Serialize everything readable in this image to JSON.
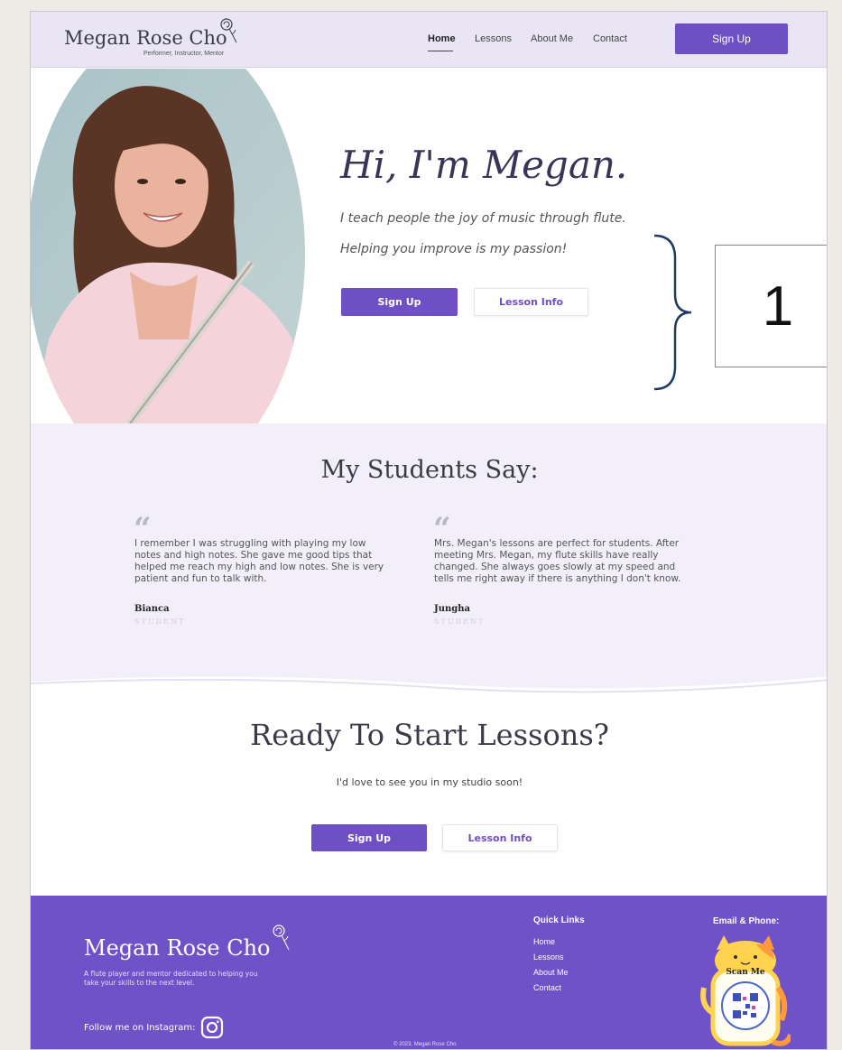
{
  "header": {
    "brand": "Megan Rose Cho",
    "tagline": "Performer, Instructor, Mentor",
    "nav": [
      "Home",
      "Lessons",
      "About Me",
      "Contact"
    ],
    "signup_label": "Sign Up"
  },
  "hero": {
    "title": "Hi, I'm Megan.",
    "line1": "I teach people the joy of music through flute.",
    "line2": "Helping you improve is my passion!",
    "signup_label": "Sign Up",
    "info_label": "Lesson Info",
    "annotation": "1"
  },
  "testimonials": {
    "title": "My Students Say:",
    "quote_glyph": "“",
    "items": [
      {
        "text": "I remember I was struggling with playing my low notes and high notes. She gave me good tips that helped me reach my high and low notes. She is very patient and fun to talk with.",
        "name": "Bianca",
        "role": "STUDENT"
      },
      {
        "text": "Mrs. Megan's lessons are perfect for students. After meeting Mrs. Megan, my flute skills have really changed. She always goes slowly at my speed and tells me right away if there is anything I don't know.",
        "name": "Jungha",
        "role": "STUDENT"
      }
    ]
  },
  "cta": {
    "title": "Ready To Start Lessons?",
    "subtitle": "I'd love to see you in my studio soon!",
    "signup_label": "Sign Up",
    "info_label": "Lesson Info"
  },
  "footer": {
    "brand": "Megan Rose Cho",
    "description": "A flute player and mentor dedicated to helping you take your skills to the next level.",
    "follow": "Follow me on Instagram:",
    "copyright": "© 2023, Megan Rose Cho",
    "quick_links_title": "Quick Links",
    "quick_links": [
      "Home",
      "Lessons",
      "About Me",
      "Contact"
    ],
    "contact_title": "Email & Phone:",
    "scan_label": "Scan Me"
  },
  "colors": {
    "accent": "#6e4fc4",
    "header_bg": "#e9e5f5",
    "testimonial_bg": "#f2effa",
    "footer_bg": "#6f51c8"
  }
}
